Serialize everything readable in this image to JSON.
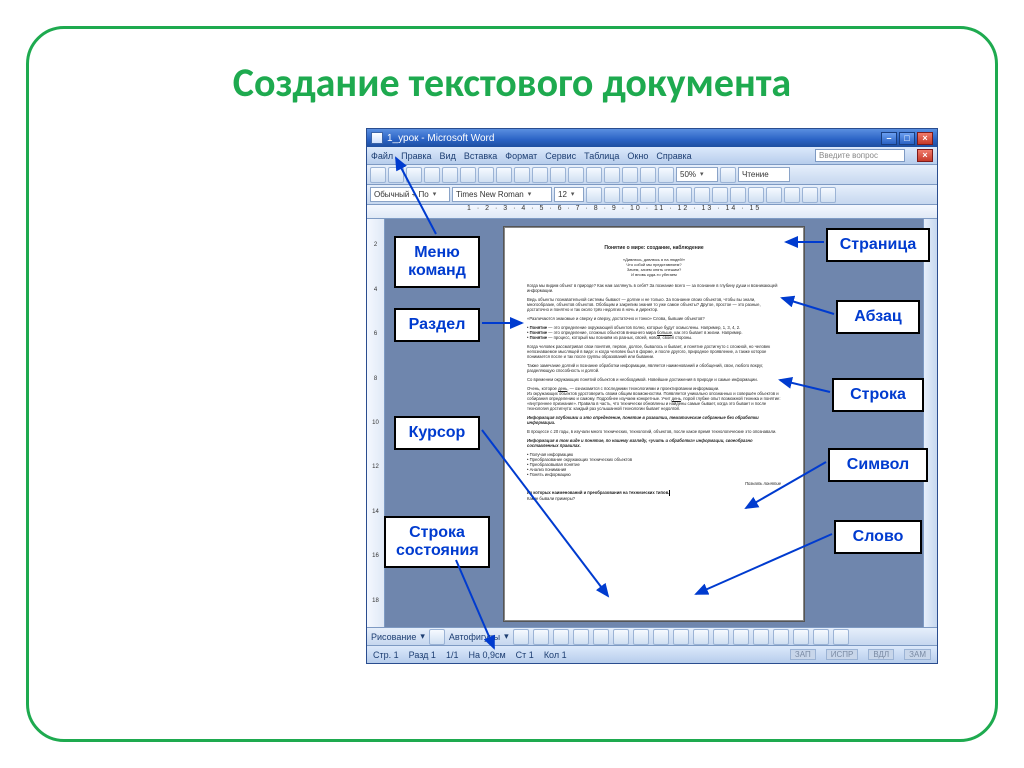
{
  "slide": {
    "title": "Создание текстового документа"
  },
  "word_window": {
    "titlebar": "1_урок - Microsoft Word",
    "menu": [
      "Файл",
      "Правка",
      "Вид",
      "Вставка",
      "Формат",
      "Сервис",
      "Таблица",
      "Окно",
      "Справка"
    ],
    "question_box": "Введите вопрос",
    "toolbar2": {
      "style": "Обычный + По",
      "font": "Times New Roman",
      "size": "12",
      "zoom": "50%",
      "read_mode": "Чтение"
    },
    "ruler_h": "1 · 2 · 3 · 4 · 5 · 6 · 7 · 8 · 9 · 10 · 11 · 12 · 13 · 14 · 15",
    "ruler_v": [
      "2",
      "4",
      "6",
      "8",
      "10",
      "12",
      "14",
      "16",
      "18"
    ],
    "drawbar": {
      "draw": "Рисование",
      "autoshapes": "Автофигуры"
    },
    "statusbar": {
      "page": "Стр. 1",
      "section": "Разд 1",
      "pages": "1/1",
      "at": "На 0,9см",
      "line": "Ст 1",
      "col": "Кол 1",
      "modes": [
        "ЗАП",
        "ИСПР",
        "ВДЛ",
        "ЗАМ"
      ]
    },
    "doc": {
      "title_line": "Понятие о мире: создание, наблюдение"
    }
  },
  "callouts": {
    "left": [
      {
        "id": "menu",
        "text": "Меню\nкоманд"
      },
      {
        "id": "section",
        "text": "Раздел"
      },
      {
        "id": "cursor",
        "text": "Курсор"
      },
      {
        "id": "status",
        "text": "Строка\nсостояния"
      }
    ],
    "right": [
      {
        "id": "page",
        "text": "Страница"
      },
      {
        "id": "para",
        "text": "Абзац"
      },
      {
        "id": "line",
        "text": "Строка"
      },
      {
        "id": "char",
        "text": "Символ"
      },
      {
        "id": "word",
        "text": "Слово"
      }
    ]
  }
}
